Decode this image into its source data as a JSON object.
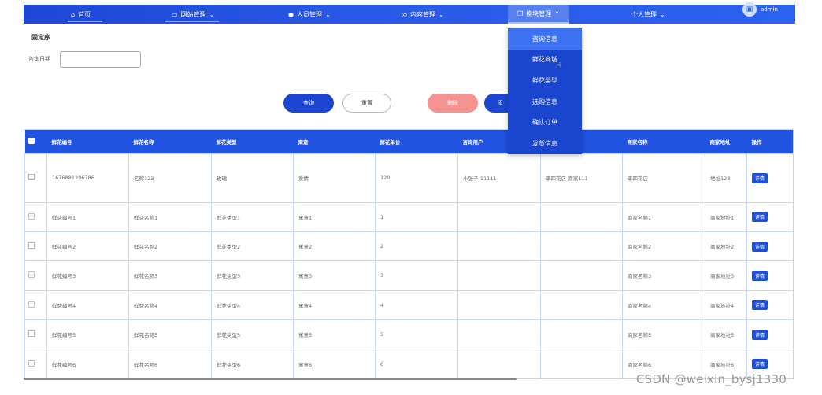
{
  "nav": {
    "home": "首页",
    "website": "网站管理",
    "people": "人员管理",
    "content": "内容管理",
    "module": "模块管理",
    "personal": "个人管理",
    "username": "admin"
  },
  "dropdown": [
    "咨询信息",
    "鲜花商城",
    "鲜花类型",
    "选购信息",
    "确认订单",
    "发货信息"
  ],
  "search": {
    "crumb": "固定序",
    "date_label": "咨询日期",
    "date_value": "",
    "query_btn": "查询",
    "reset_btn": "重置",
    "delete_btn": "删除",
    "add_btn": "添"
  },
  "table": {
    "headers": [
      "鲜花编号",
      "鲜花名称",
      "鲜花类型",
      "寓意",
      "鲜花单价",
      "咨询用户",
      "",
      "商家名称",
      "商家地址",
      "操作"
    ],
    "detail_label": "详情",
    "rows": [
      [
        "1676881206786",
        "名称123",
        "玫瑰",
        "爱情",
        "120",
        "小张子-11111",
        "李四花店-商家111",
        "李四花店",
        "地址123"
      ],
      [
        "鲜花编号1",
        "鲜花名称1",
        "鲜花类型1",
        "寓意1",
        "1",
        "",
        "",
        "商家名称1",
        "商家地址1"
      ],
      [
        "鲜花编号2",
        "鲜花名称2",
        "鲜花类型2",
        "寓意2",
        "2",
        "",
        "",
        "商家名称2",
        "商家地址2"
      ],
      [
        "鲜花编号3",
        "鲜花名称3",
        "鲜花类型3",
        "寓意3",
        "3",
        "",
        "",
        "商家名称3",
        "商家地址3"
      ],
      [
        "鲜花编号4",
        "鲜花名称4",
        "鲜花类型4",
        "寓意4",
        "4",
        "",
        "",
        "商家名称4",
        "商家地址4"
      ],
      [
        "鲜花编号5",
        "鲜花名称5",
        "鲜花类型5",
        "寓意5",
        "5",
        "",
        "",
        "商家名称5",
        "商家地址5"
      ],
      [
        "鲜花编号6",
        "鲜花名称6",
        "鲜花类型6",
        "寓意6",
        "6",
        "",
        "",
        "商家名称6",
        "商家地址6"
      ]
    ]
  },
  "watermark": "CSDN @weixin_bysj1330",
  "colors": {
    "primary": "#2152e0",
    "danger": "#f4938f",
    "dropdown_bg": "#1a45cf"
  }
}
